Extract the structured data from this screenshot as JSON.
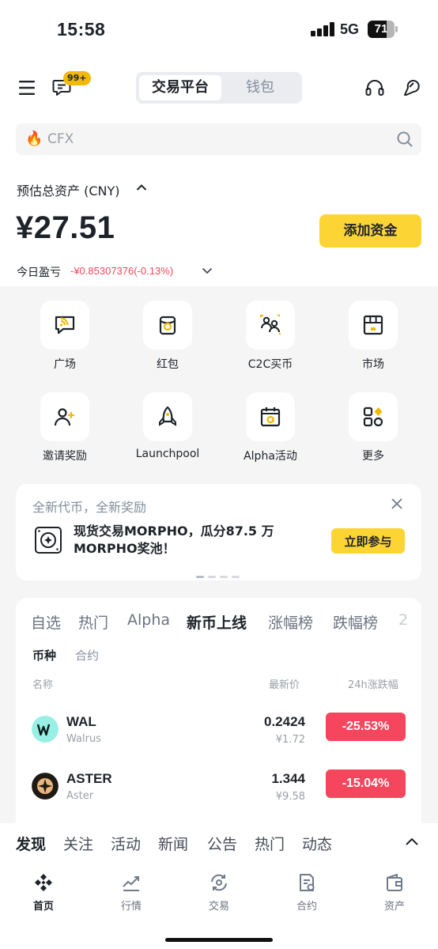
{
  "status_bar": {
    "time": "15:58",
    "network": "5G",
    "battery": "71",
    "battery_level": 0.71
  },
  "header": {
    "notification_badge": "99+",
    "segment_tabs": [
      {
        "label": "交易平台",
        "active": true
      },
      {
        "label": "钱包",
        "active": false
      }
    ],
    "search": {
      "placeholder": "CFX"
    }
  },
  "assets": {
    "label": "预估总资产 (CNY)",
    "amount": "¥27.51",
    "add_funds_label": "添加资金",
    "today_pnl_label": "今日盈亏",
    "today_pnl_value": "-¥0.85307376(-0.13%)"
  },
  "shortcuts": [
    {
      "label": "广场",
      "icon": "square-feed-icon"
    },
    {
      "label": "红包",
      "icon": "red-packet-icon"
    },
    {
      "label": "C2C买币",
      "icon": "c2c-icon"
    },
    {
      "label": "市场",
      "icon": "store-icon"
    },
    {
      "label": "邀请奖励",
      "icon": "invite-icon"
    },
    {
      "label": "Launchpool",
      "icon": "rocket-icon"
    },
    {
      "label": "Alpha活动",
      "icon": "calendar-alpha-icon"
    },
    {
      "label": "更多",
      "icon": "more-apps-icon"
    }
  ],
  "promo": {
    "title": "全新代币，全新奖励",
    "text": "现货交易MORPHO，瓜分87.5 万MORPHO奖池！",
    "button": "立即参与"
  },
  "market": {
    "tabs": [
      "自选",
      "热门",
      "Alpha",
      "新币上线",
      "涨幅榜",
      "跌幅榜",
      "2"
    ],
    "active_tab": "新币上线",
    "sub_tabs": [
      "币种",
      "合约"
    ],
    "active_sub_tab": "币种",
    "columns": {
      "name": "名称",
      "price": "最新价",
      "change": "24h涨跌幅"
    },
    "rows": [
      {
        "symbol": "WAL",
        "name": "Walrus",
        "price": "0.2424",
        "price_cny": "¥1.72",
        "change": "-25.53%",
        "color": "#f6465d"
      },
      {
        "symbol": "ASTER",
        "name": "Aster",
        "price": "1.344",
        "price_cny": "¥9.58",
        "change": "-15.04%",
        "color": "#f6465d"
      }
    ]
  },
  "discover": {
    "tabs": [
      "发现",
      "关注",
      "活动",
      "新闻",
      "公告",
      "热门",
      "动态"
    ],
    "active": "发现"
  },
  "bottom_nav": [
    {
      "label": "首页",
      "active": true
    },
    {
      "label": "行情",
      "active": false
    },
    {
      "label": "交易",
      "active": false
    },
    {
      "label": "合约",
      "active": false
    },
    {
      "label": "资产",
      "active": false
    }
  ],
  "colors": {
    "brand_yellow": "#fcd535",
    "down_red": "#f6465d",
    "text": "#1e2329",
    "muted": "#848e9c"
  }
}
